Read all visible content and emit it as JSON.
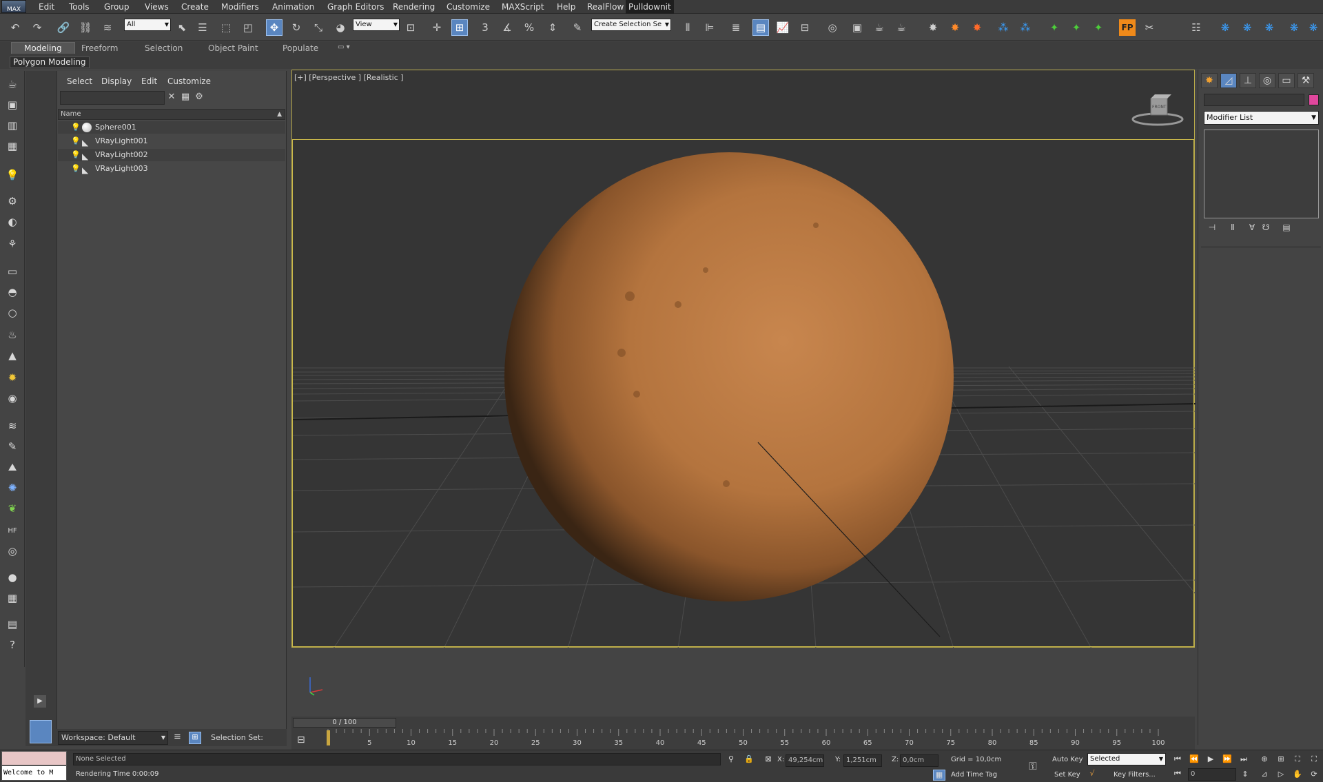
{
  "app": {
    "logo": "MAX"
  },
  "menubar": {
    "items": [
      "Edit",
      "Tools",
      "Group",
      "Views",
      "Create",
      "Modifiers",
      "Animation",
      "Graph Editors",
      "Rendering",
      "Customize",
      "MAXScript",
      "Help",
      "RealFlow"
    ],
    "active": "Pulldownit"
  },
  "toolbar": {
    "selection_filter": "All",
    "ref_coord": "View",
    "named_sel": "Create Selection Se",
    "snap_label": "3"
  },
  "ribbon": {
    "tabs": [
      "Modeling",
      "Freeform",
      "Selection",
      "Object Paint",
      "Populate"
    ],
    "active": "Modeling",
    "sub_label": "Polygon Modeling"
  },
  "explorer": {
    "menus": [
      "Select",
      "Display",
      "Edit",
      "Customize"
    ],
    "column_header": "Name",
    "rows": [
      {
        "name": "Sphere001",
        "type": "sphere"
      },
      {
        "name": "VRayLight001",
        "type": "light"
      },
      {
        "name": "VRayLight002",
        "type": "light"
      },
      {
        "name": "VRayLight003",
        "type": "light"
      }
    ],
    "workspace": "Workspace: Default",
    "selection_set_label": "Selection Set:"
  },
  "viewport": {
    "label": "[+] [Perspective ] [Realistic ]",
    "viewcube_label": "FRONT",
    "sphere_color": "#b4743e",
    "border_color": "#c9b84b"
  },
  "command_panel": {
    "modifier_list": "Modifier List",
    "object_color": "#e0479d"
  },
  "timeline": {
    "frame_display": "0 / 100",
    "ticks": [
      "5",
      "10",
      "15",
      "20",
      "25",
      "30",
      "35",
      "40",
      "45",
      "50",
      "55",
      "60",
      "65",
      "70",
      "75",
      "80",
      "85",
      "90",
      "95",
      "100"
    ]
  },
  "status": {
    "listener_text": "Welcome to M",
    "selection": "None Selected",
    "render_time": "Rendering Time  0:00:09",
    "x_label": "X:",
    "x_value": "49,254cm",
    "y_label": "Y:",
    "y_value": "1,251cm",
    "z_label": "Z:",
    "z_value": "0,0cm",
    "grid": "Grid = 10,0cm",
    "add_time_tag": "Add Time Tag",
    "auto_key": "Auto Key",
    "set_key": "Set Key",
    "key_mode": "Selected",
    "key_filters": "Key Filters...",
    "current_frame": "0"
  }
}
